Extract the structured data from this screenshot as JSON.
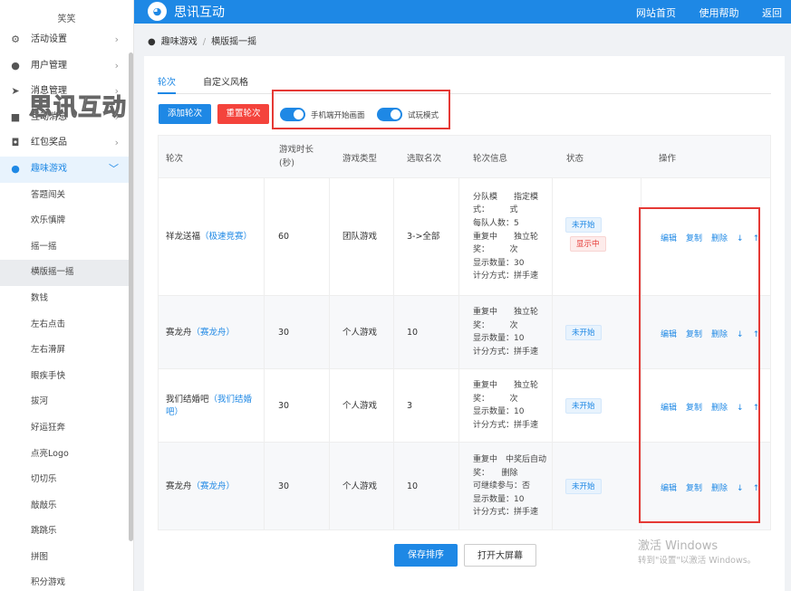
{
  "brand": {
    "name": "思讯互动",
    "watermark": "思讯互动"
  },
  "topnav": [
    "网站首页",
    "使用帮助",
    "返回"
  ],
  "sidebar": {
    "user": "笑笑",
    "menu": [
      {
        "label": "活动设置",
        "icon": "gear-icon",
        "glyph": "⚙"
      },
      {
        "label": "用户管理",
        "icon": "user-icon",
        "glyph": "●"
      },
      {
        "label": "消息管理",
        "icon": "send-icon",
        "glyph": "➤"
      },
      {
        "label": "互动消息",
        "icon": "chat-icon",
        "glyph": "■"
      },
      {
        "label": "红包奖品",
        "icon": "gift-icon",
        "glyph": "◘"
      },
      {
        "label": "趣味游戏",
        "icon": "gamepad-icon",
        "glyph": "●",
        "open": true
      }
    ],
    "submenu": [
      "答题闯关",
      "欢乐慎牌",
      "摇一摇",
      "横版摇一摇",
      "数钱",
      "左右点击",
      "左右滑屏",
      "眼疾手快",
      "拔河",
      "好运狂奔",
      "点亮Logo",
      "切切乐",
      "敲敲乐",
      "跳跳乐",
      "拼图",
      "积分游戏"
    ],
    "active_sub": 3
  },
  "breadcrumb": [
    "趣味游戏",
    "横版摇一摇"
  ],
  "tabs": [
    "轮次",
    "自定义风格"
  ],
  "buttons": {
    "add_round": "添加轮次",
    "reset_round": "重置轮次",
    "save_sort": "保存排序",
    "open_screen": "打开大屏幕"
  },
  "toggles": [
    {
      "label": "手机端开始画面",
      "on": true
    },
    {
      "label": "试玩模式",
      "on": true
    }
  ],
  "table": {
    "headers": [
      "轮次",
      "游戏时长\n(秒)",
      "游戏类型",
      "选取名次",
      "轮次信息",
      "状态",
      "操作"
    ],
    "rows": [
      {
        "name": "祥龙送福",
        "name_link": "（极速竞赛）",
        "duration": "60",
        "type": "团队游戏",
        "rank": "3->全部",
        "info": [
          "分队模　　指定模",
          "式：　　　式",
          "每队人数：5",
          "重复中　　独立轮",
          "奖：　　　次",
          "显示数量：30",
          "计分方式：拼手速"
        ],
        "status": [
          "未开始",
          "显示中"
        ]
      },
      {
        "name": "赛龙舟",
        "name_link": "（赛龙舟）",
        "duration": "30",
        "type": "个人游戏",
        "rank": "10",
        "info": [
          "重复中　　独立轮",
          "奖：　　　次",
          "显示数量：10",
          "计分方式：拼手速"
        ],
        "status": [
          "未开始"
        ]
      },
      {
        "name": "我们结婚吧",
        "name_link": "（我们结婚吧）",
        "duration": "30",
        "type": "个人游戏",
        "rank": "3",
        "info": [
          "重复中　　独立轮",
          "奖：　　　次",
          "显示数量：10",
          "计分方式：拼手速"
        ],
        "status": [
          "未开始"
        ]
      },
      {
        "name": "赛龙舟",
        "name_link": "（赛龙舟）",
        "duration": "30",
        "type": "个人游戏",
        "rank": "10",
        "info": [
          "重复中　中奖后自动",
          "奖：　　删除",
          "可继续参与：否",
          "显示数量：10",
          "计分方式：拼手速"
        ],
        "status": [
          "未开始"
        ]
      }
    ],
    "ops": [
      "编辑",
      "复制",
      "删除",
      "↓",
      "↑"
    ]
  },
  "windows_watermark": {
    "line1": "激活 Windows",
    "line2": "转到\"设置\"以激活 Windows。"
  },
  "colors": {
    "primary": "#1e88e5",
    "danger": "#f4433c",
    "annotation": "#e53935"
  }
}
